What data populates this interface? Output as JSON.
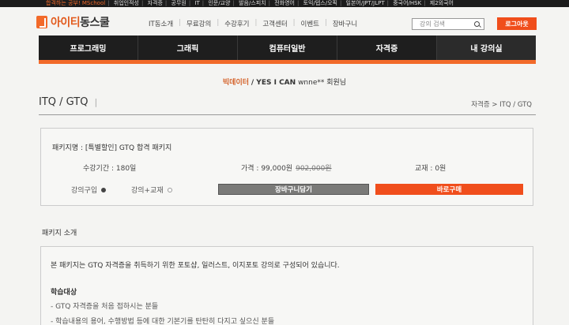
{
  "topbar": {
    "items": [
      "합격하는 공부! MSchool",
      "취업인적성",
      "자격증",
      "공무원",
      "IT",
      "인문/교양",
      "발음/스피치",
      "전화영어",
      "토익/텝스/오픽",
      "일본어/JPT/JLPT",
      "중국어/HSK",
      "제2외국어"
    ]
  },
  "header": {
    "logo_text_a": "아이티",
    "logo_text_b": "동스쿨",
    "nav": [
      "IT동소개",
      "무료강의",
      "수강후기",
      "고객센터",
      "이벤트",
      "장바구니"
    ],
    "search_placeholder": "강의 검색",
    "login_label": "로그아웃"
  },
  "mainnav": {
    "tabs": [
      "프로그래밍",
      "그래픽",
      "컴퓨터일반",
      "자격증",
      "내 강의실"
    ]
  },
  "welcome": {
    "brand": "빅데이터",
    "slogan": "/ YES I CAN",
    "user": "wnne**",
    "suffix": "회원님"
  },
  "page": {
    "title": "ITQ / GTQ",
    "title_bar": "|",
    "breadcrumb": "자격증 > ITQ / GTQ"
  },
  "package": {
    "name": "패키지명 : [특별할인] GTQ 합격 패키지",
    "period": "수강기간 : 180일",
    "price_label": "가격 : 99,000원",
    "price_original": "902,000원",
    "textbook": "교재 : 0원",
    "option_lecture": "강의구입",
    "option_lecture_textbook": "강의+교재",
    "cart_label": "장바구니담기",
    "buy_label": "바로구매"
  },
  "intro": {
    "heading": "패키지 소개",
    "description": "본 패키지는 GTQ 자격증을 취득하기 위한 포토샵, 일러스트, 이지포토 강의로 구성되어 있습니다.",
    "target_heading": "학습대상",
    "target_items": [
      "- GTQ 자격증을 처음 접하시는 분들",
      "- 학습내용의 용어, 수행방법 등에 대한 기본기를 탄탄히 다지고 싶으신 분들"
    ]
  },
  "colors": {
    "accent": "#f26a2a",
    "buy": "#f04e1c",
    "nav_bg": "#1e1e1e"
  }
}
